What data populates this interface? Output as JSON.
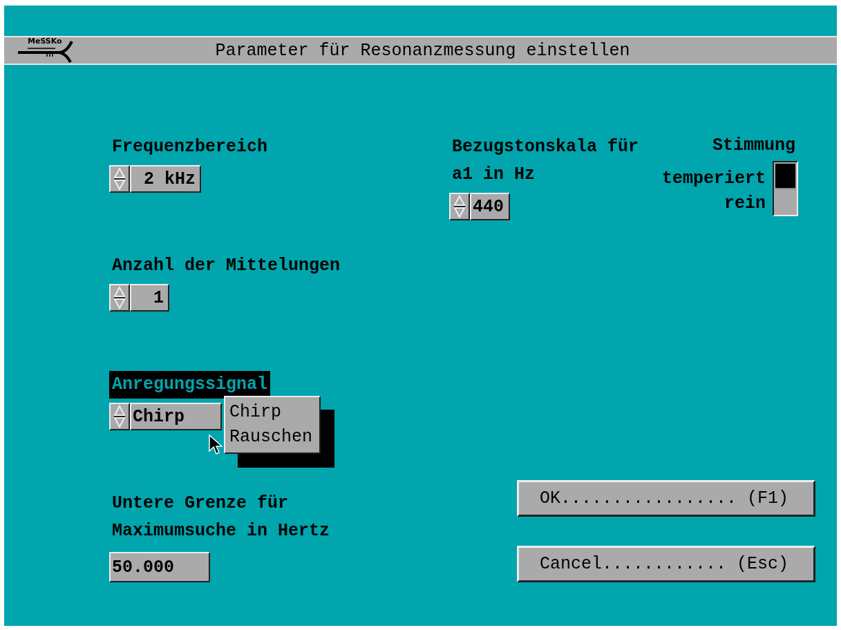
{
  "window": {
    "logo_text": "MeSSKo",
    "title": "Parameter für Resonanzmessung einstellen"
  },
  "left_fields": [
    {
      "kind": "spinner",
      "label": [
        "Frequenzbereich"
      ],
      "value": "2 kHz",
      "focused": false
    },
    {
      "kind": "spinner",
      "label": [
        "Anzahl der Mittelungen"
      ],
      "value": "1",
      "focused": false
    },
    {
      "kind": "spinner",
      "label": [
        "Anregungssignal"
      ],
      "value": "Chirp",
      "focused": true,
      "dropdown": [
        "Chirp",
        "Rauschen"
      ]
    },
    {
      "kind": "input",
      "label": [
        "Untere Grenze für",
        "Maximumsuche in Hertz"
      ],
      "value": "50.000",
      "focused": false
    }
  ],
  "reference": {
    "label": [
      "Bezugstonskala für",
      "a1 in Hz"
    ],
    "value": "440"
  },
  "tuning": {
    "title": "Stimmung",
    "options": [
      {
        "label": "temperiert",
        "selected": true
      },
      {
        "label": "rein",
        "selected": false
      }
    ]
  },
  "buttons": [
    {
      "label": "OK................. (F1)"
    },
    {
      "label": "Cancel............ (Esc)"
    }
  ]
}
